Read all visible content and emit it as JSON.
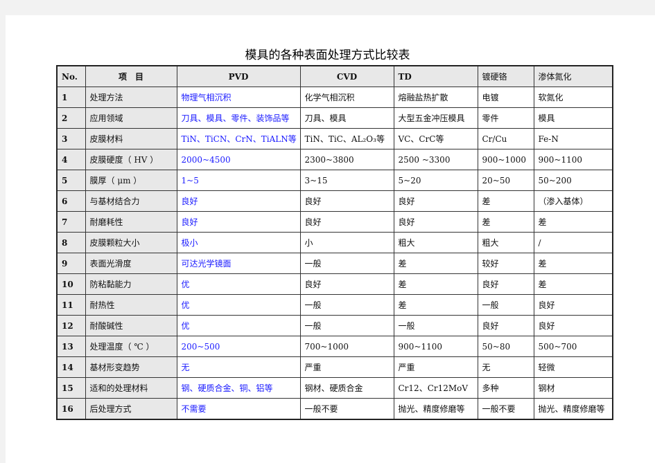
{
  "document": {
    "title": "模具的各种表面处理方式比较表"
  },
  "table": {
    "headers": [
      "No.",
      "项　目",
      "PVD",
      "CVD",
      "TD",
      "镀硬铬",
      "渗体氮化"
    ],
    "accent_color": "#1a1aff",
    "rows": [
      {
        "no": "1",
        "item": "处理方法",
        "pvd": "物理气相沉积",
        "cvd": "化学气相沉积",
        "td": "熔融盐热扩散",
        "chrome": "电镀",
        "nitride": "软氮化"
      },
      {
        "no": "2",
        "item": "应用领域",
        "pvd": "刀具、模具、零件、装饰品等",
        "cvd": "刀具、模具",
        "td": "大型五金冲压模具",
        "chrome": "零件",
        "nitride": "模具"
      },
      {
        "no": "3",
        "item": "皮膜材料",
        "pvd": "TiN、TiCN、CrN、TiALN等",
        "cvd": "TiN、TiC、AL₂O₃等",
        "td": "VC、CrC等",
        "chrome": "Cr/Cu",
        "nitride": "Fe-N"
      },
      {
        "no": "4",
        "item": "皮膜硬度（ HV ）",
        "pvd": "2000~4500",
        "cvd": "2300~3800",
        "td": "2500 ~3300",
        "chrome": "900~1000",
        "nitride": "900~1100"
      },
      {
        "no": "5",
        "item": "膜厚（ μm ）",
        "pvd": "1~5",
        "cvd": "3~15",
        "td": "5~20",
        "chrome": "20~50",
        "nitride": "50~200"
      },
      {
        "no": "6",
        "item": "与基材结合力",
        "pvd": "良好",
        "cvd": "良好",
        "td": "良好",
        "chrome": "差",
        "nitride": "（渗入基体）"
      },
      {
        "no": "7",
        "item": "耐磨耗性",
        "pvd": "良好",
        "cvd": "良好",
        "td": "良好",
        "chrome": "差",
        "nitride": "差"
      },
      {
        "no": "8",
        "item": "皮膜颗粒大小",
        "pvd": "极小",
        "cvd": "小",
        "td": "粗大",
        "chrome": "粗大",
        "nitride": "/"
      },
      {
        "no": "9",
        "item": "表面光滑度",
        "pvd": "可达光学镜面",
        "cvd": "一般",
        "td": "差",
        "chrome": "较好",
        "nitride": "差"
      },
      {
        "no": "10",
        "item": "防粘黏能力",
        "pvd": "优",
        "cvd": "良好",
        "td": "差",
        "chrome": "良好",
        "nitride": "差"
      },
      {
        "no": "11",
        "item": "耐热性",
        "pvd": "优",
        "cvd": "一般",
        "td": "差",
        "chrome": "一般",
        "nitride": "良好"
      },
      {
        "no": "12",
        "item": "耐酸碱性",
        "pvd": "优",
        "cvd": "一般",
        "td": "一般",
        "chrome": "良好",
        "nitride": "良好"
      },
      {
        "no": "13",
        "item": "处理温度（ ℃ ）",
        "pvd": "200~500",
        "cvd": "700~1000",
        "td": "900~1100",
        "chrome": "50~80",
        "nitride": "500~700"
      },
      {
        "no": "14",
        "item": "基材形变趋势",
        "pvd": "无",
        "cvd": "严重",
        "td": "严重",
        "chrome": "无",
        "nitride": "轻微"
      },
      {
        "no": "15",
        "item": "适和的处理材料",
        "pvd": "钢、硬质合金、铜、铝等",
        "cvd": "钢材、硬质合金",
        "td": "Cr12、Cr12MoV",
        "chrome": "多种",
        "nitride": "钢材"
      },
      {
        "no": "16",
        "item": "后处理方式",
        "pvd": "不需要",
        "cvd": "一般不要",
        "td": "抛光、精度修磨等",
        "chrome": "一般不要",
        "nitride": "抛光、精度修磨等"
      }
    ]
  }
}
